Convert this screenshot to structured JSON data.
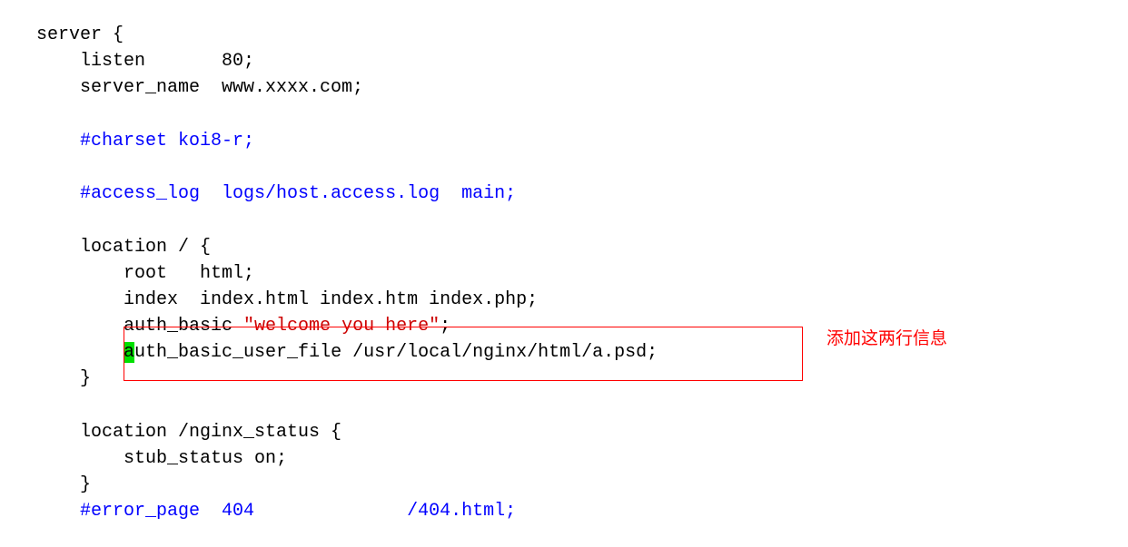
{
  "code": {
    "line1a": "server {",
    "line2": "    listen       80;",
    "line3": "    server_name  www.xxxx.com;",
    "blank1": "",
    "line4": "    #charset koi8-r;",
    "blank2": "",
    "line5": "    #access_log  logs/host.access.log  main;",
    "blank3": "",
    "line6": "    location / {",
    "line7": "        root   html;",
    "line8": "        index  index.html index.htm index.php;",
    "line9a": "        auth_basic ",
    "line9b": "\"welcome you here\"",
    "line9c": ";",
    "line10b": "uth_basic_user_file /usr/local/nginx/html/a.psd;",
    "line10pad": "        ",
    "line10a_char": "a",
    "line11": "    }",
    "blank4": "",
    "line12": "    location /nginx_status {",
    "line13": "        stub_status on;",
    "line14": "    }",
    "line15": "    #error_page  404              /404.html;"
  },
  "annotation": {
    "label": "添加这两行信息"
  }
}
